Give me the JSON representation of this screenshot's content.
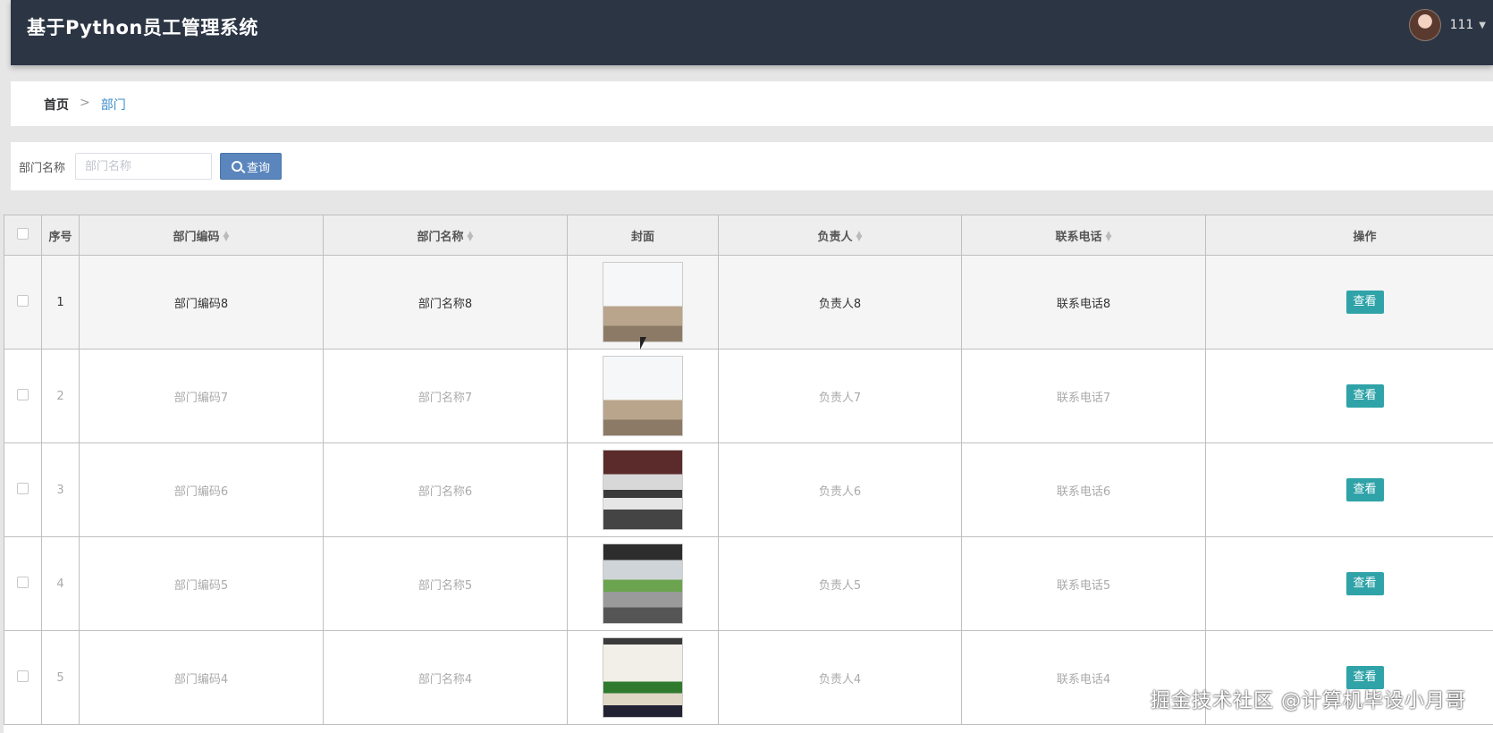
{
  "header": {
    "title": "基于Python员工管理系统",
    "username": "111"
  },
  "breadcrumb": {
    "home": "首页",
    "separator": ">",
    "current": "部门"
  },
  "search": {
    "label": "部门名称",
    "placeholder": "部门名称",
    "value": "",
    "button_label": "查询"
  },
  "table": {
    "headers": {
      "index": "序号",
      "code": "部门编码",
      "name": "部门名称",
      "cover": "封面",
      "manager": "负责人",
      "phone": "联系电话",
      "action": "操作"
    },
    "rows": [
      {
        "index": "1",
        "code": "部门编码8",
        "name": "部门名称8",
        "manager": "负责人8",
        "phone": "联系电话8",
        "action": "查看"
      },
      {
        "index": "2",
        "code": "部门编码7",
        "name": "部门名称7",
        "manager": "负责人7",
        "phone": "联系电话7",
        "action": "查看"
      },
      {
        "index": "3",
        "code": "部门编码6",
        "name": "部门名称6",
        "manager": "负责人6",
        "phone": "联系电话6",
        "action": "查看"
      },
      {
        "index": "4",
        "code": "部门编码5",
        "name": "部门名称5",
        "manager": "负责人5",
        "phone": "联系电话5",
        "action": "查看"
      },
      {
        "index": "5",
        "code": "部门编码4",
        "name": "部门名称4",
        "manager": "负责人4",
        "phone": "联系电话4",
        "action": "查看"
      }
    ]
  },
  "watermark": "掘金技术社区 @计算机毕设小月哥",
  "colors": {
    "header_bg": "#2c3544",
    "search_button": "#5b86bd",
    "view_button": "#2fa3a8",
    "breadcrumb_active": "#3a8bc8"
  }
}
